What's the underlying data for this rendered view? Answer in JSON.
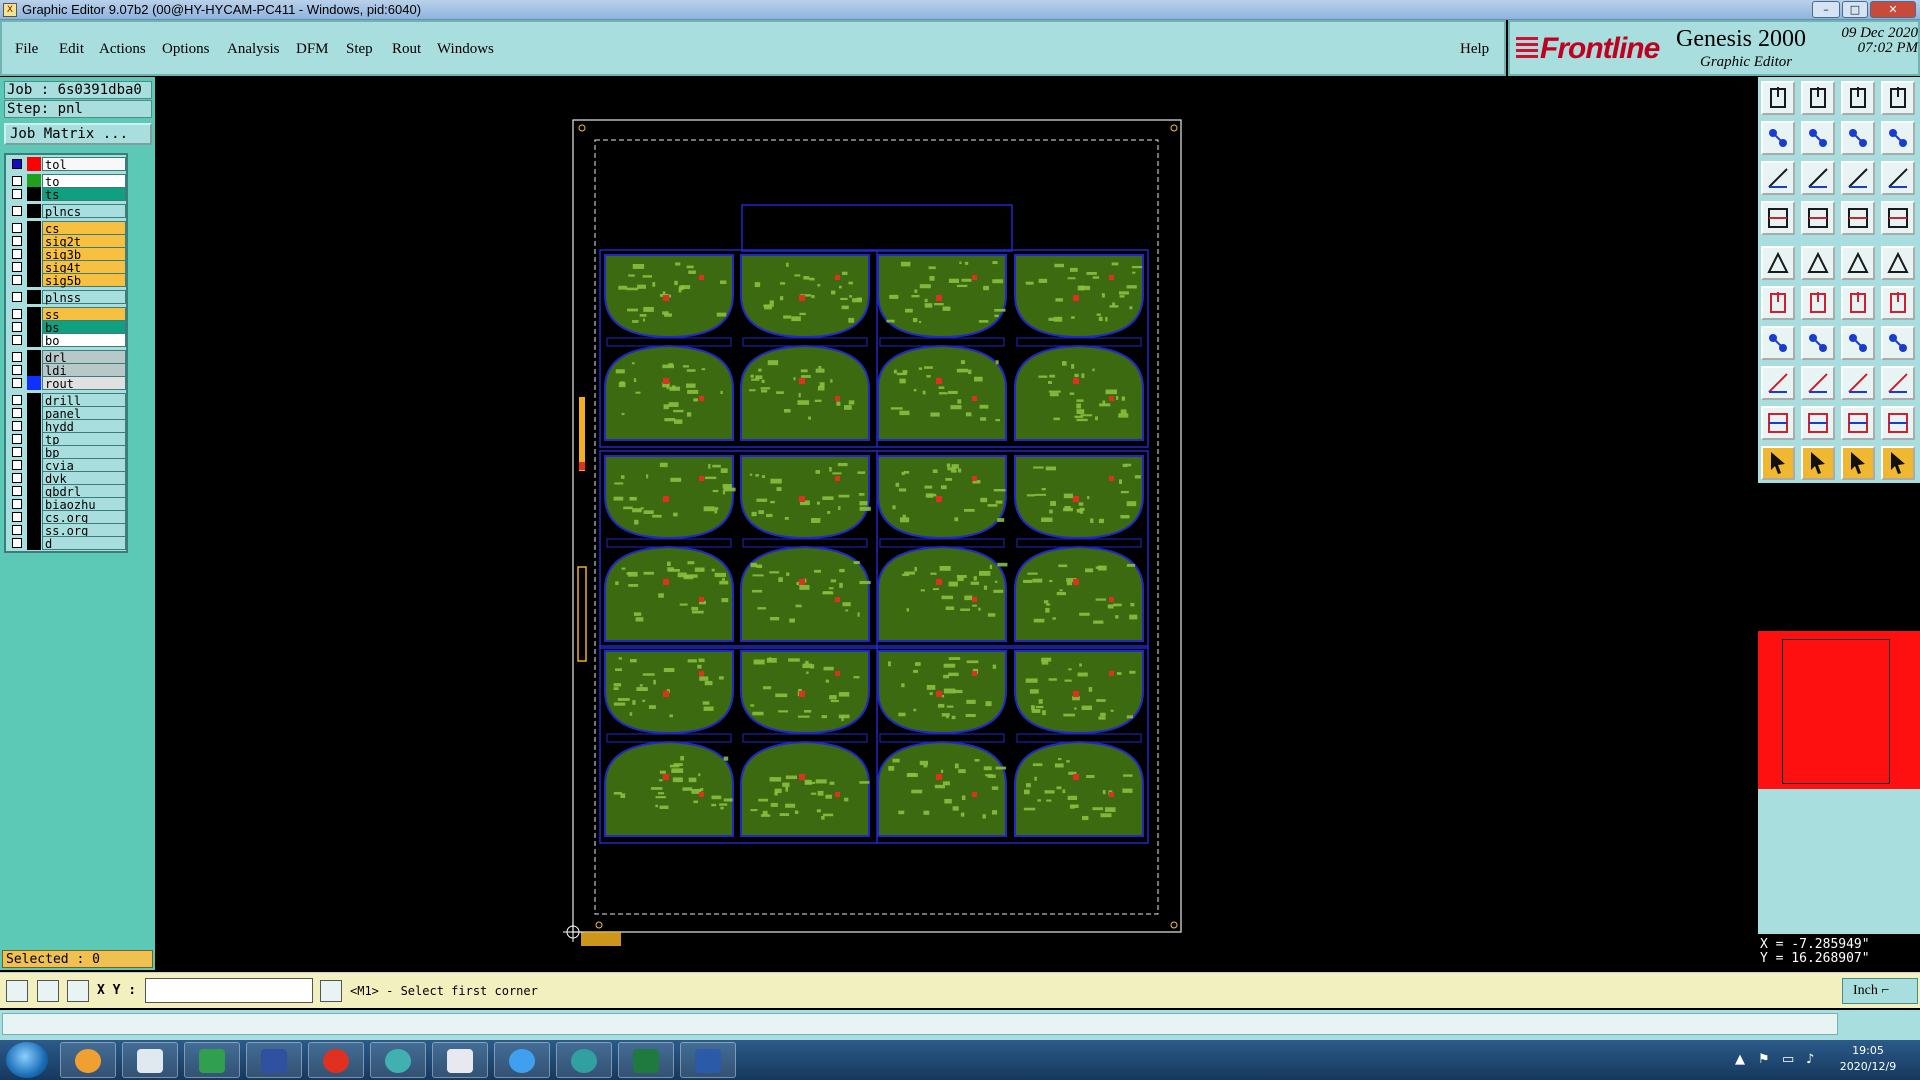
{
  "window": {
    "title": "Graphic Editor 9.07b2 (00@HY-HYCAM-PC411 - Windows, pid:6040)",
    "icon_glyph": "X",
    "controls": [
      "–",
      "□",
      "✕"
    ]
  },
  "menu": {
    "items": [
      "File",
      "Edit",
      "Actions",
      "Options",
      "Analysis",
      "DFM",
      "Step",
      "Rout",
      "Windows"
    ],
    "help": "Help"
  },
  "logo": {
    "brand": "Frontline",
    "product": "Genesis 2000",
    "subtitle": "Graphic Editor",
    "date_line1": "09  Dec  2020",
    "date_line2": "07:02  PM"
  },
  "job": {
    "job_label": "Job : 6s0391dba0",
    "step_label": "Step: pnl",
    "matrix_button": "Job Matrix ..."
  },
  "layers": [
    {
      "name": "tol",
      "swatch": "#ff0000",
      "bg": "#f8f8f8",
      "checkbox": "#1010c0"
    },
    {
      "name": "to",
      "swatch": "#20a020",
      "bg": "#ffffff"
    },
    {
      "name": "ts",
      "swatch": "#000000",
      "bg": "#10a080"
    },
    {
      "name": "plncs",
      "swatch": "#000000",
      "bg": "#a8dedd"
    },
    {
      "name": "cs",
      "swatch": "#000000",
      "bg": "#f8c040"
    },
    {
      "name": "sig2t",
      "swatch": "#000000",
      "bg": "#f8c040"
    },
    {
      "name": "sig3b",
      "swatch": "#000000",
      "bg": "#f8c040"
    },
    {
      "name": "sig4t",
      "swatch": "#000000",
      "bg": "#f8c040"
    },
    {
      "name": "sig5b",
      "swatch": "#000000",
      "bg": "#f8c040"
    },
    {
      "name": "plnss",
      "swatch": "#000000",
      "bg": "#a8dedd"
    },
    {
      "name": "ss",
      "swatch": "#000000",
      "bg": "#f8c040"
    },
    {
      "name": "bs",
      "swatch": "#000000",
      "bg": "#10a080"
    },
    {
      "name": "bo",
      "swatch": "#000000",
      "bg": "#ffffff"
    },
    {
      "name": "drl",
      "swatch": "#000000",
      "bg": "#b8c8c8"
    },
    {
      "name": "ldi",
      "swatch": "#000000",
      "bg": "#b8c8c8"
    },
    {
      "name": "rout",
      "swatch": "#1030ff",
      "bg": "#e0e0e0"
    },
    {
      "name": "drill",
      "swatch": "#000000",
      "bg": "#a8dedd"
    },
    {
      "name": "panel",
      "swatch": "#000000",
      "bg": "#a8dedd"
    },
    {
      "name": "hydd",
      "swatch": "#000000",
      "bg": "#a8dedd"
    },
    {
      "name": "tp",
      "swatch": "#000000",
      "bg": "#a8dedd"
    },
    {
      "name": "bp",
      "swatch": "#000000",
      "bg": "#a8dedd"
    },
    {
      "name": "cvia",
      "swatch": "#000000",
      "bg": "#a8dedd"
    },
    {
      "name": "dvk",
      "swatch": "#000000",
      "bg": "#a8dedd"
    },
    {
      "name": "gbdrl",
      "swatch": "#000000",
      "bg": "#a8dedd"
    },
    {
      "name": "biaozhu",
      "swatch": "#000000",
      "bg": "#a8dedd"
    },
    {
      "name": "cs.org",
      "swatch": "#000000",
      "bg": "#a8dedd"
    },
    {
      "name": "ss.org",
      "swatch": "#000000",
      "bg": "#a8dedd"
    },
    {
      "name": "d",
      "swatch": "#000000",
      "bg": "#a8dedd"
    }
  ],
  "selected": "Selected : 0",
  "coords": {
    "x": "X = -7.285949\"",
    "y": "Y = 16.268907\""
  },
  "status": {
    "xy_label": "X Y :",
    "xy_value": "",
    "message": "<M1> - Select first corner",
    "units": "Inch ⌐"
  },
  "taskbar": {
    "time": "19:05",
    "date": "2020/12/9"
  },
  "colors": {
    "panel_bg": "#a8dedd",
    "board_green": "#5a9a20",
    "outline_blue": "#2020c0",
    "preview_red": "#ff1010"
  }
}
